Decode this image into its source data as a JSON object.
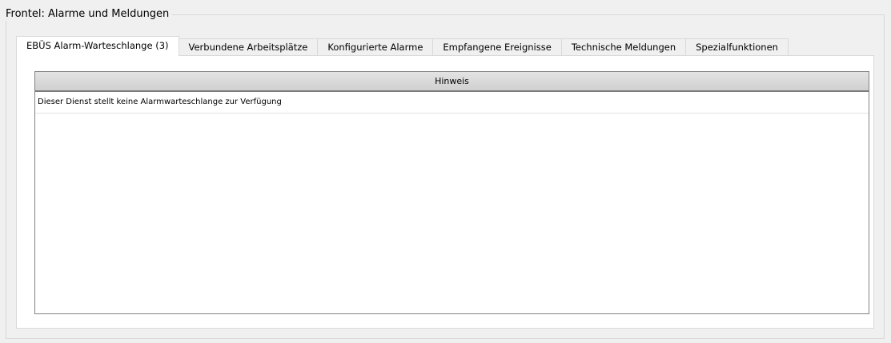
{
  "group": {
    "title": "Frontel: Alarme und Meldungen"
  },
  "tabs": [
    {
      "label": "EBÜS Alarm-Warteschlange (3)",
      "active": true
    },
    {
      "label": "Verbundene Arbeitsplätze",
      "active": false
    },
    {
      "label": "Konfigurierte Alarme",
      "active": false
    },
    {
      "label": "Empfangene Ereignisse",
      "active": false
    },
    {
      "label": "Technische Meldungen",
      "active": false
    },
    {
      "label": "Spezialfunktionen",
      "active": false
    }
  ],
  "table": {
    "columns": [
      "Hinweis"
    ],
    "rows": [
      [
        "Dieser Dienst stellt keine Alarmwarteschlange zur Verfügung"
      ]
    ]
  }
}
